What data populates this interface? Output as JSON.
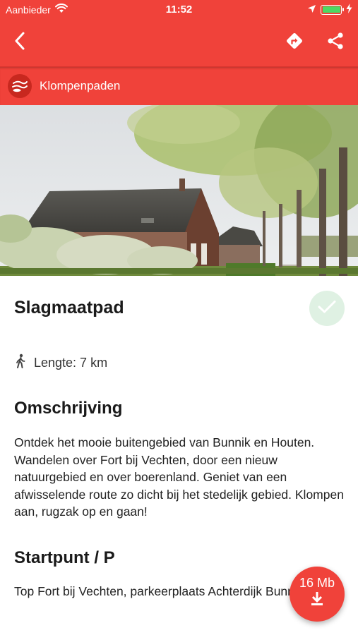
{
  "status_bar": {
    "carrier": "Aanbieder",
    "time": "11:52",
    "battery_level": 1.0,
    "icons": [
      "wifi-icon",
      "location-arrow-icon",
      "battery-icon",
      "charging-bolt-icon"
    ]
  },
  "nav": {
    "icons": [
      "back-chevron-icon",
      "directions-icon",
      "share-icon"
    ]
  },
  "provider": {
    "name": "Klompenpaden",
    "icon": "klompenpaden-logo"
  },
  "route": {
    "title": "Slagmaatpad",
    "length_text": "Lengte: 7 km",
    "visited_icon": "check-icon",
    "length_icon": "walking-person-icon"
  },
  "description": {
    "heading": "Omschrijving",
    "text": "Ontdek het mooie buitengebied van Bunnik en Houten. Wandelen over Fort bij Vechten, door een nieuw natuurgebied en over boerenland. Geniet van een afwisselende route zo dicht bij het stedelijk gebied. Klompen aan, rugzak op en gaan!"
  },
  "start": {
    "heading": "Startpunt / P",
    "text": "Top Fort bij Vechten, parkeerplaats Achterdijk Bunnik"
  },
  "download": {
    "size_label": "16 Mb",
    "icon": "download-icon"
  },
  "colors": {
    "brand_red": "#f0423a",
    "check_bg": "#dff1e3",
    "check_mark": "#ffffff"
  }
}
